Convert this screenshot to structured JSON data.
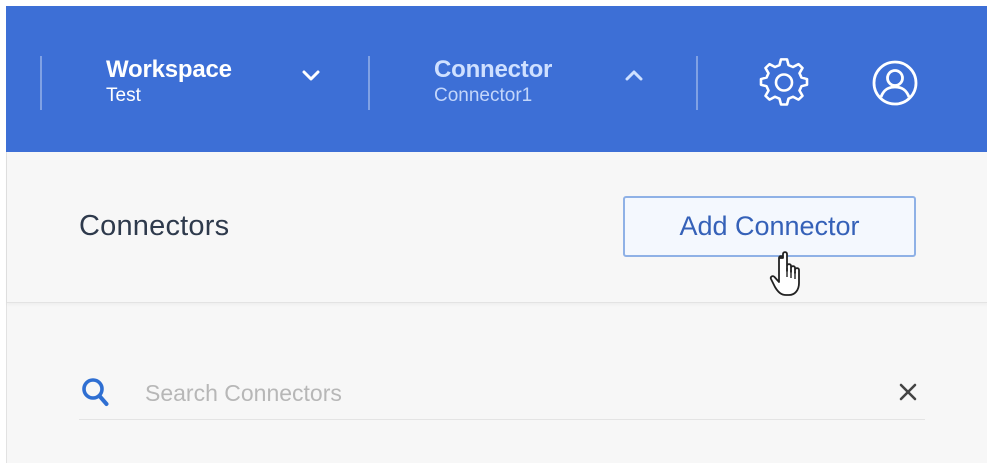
{
  "header": {
    "workspace": {
      "title": "Workspace",
      "value": "Test"
    },
    "connector": {
      "title": "Connector",
      "value": "Connector1"
    }
  },
  "panel": {
    "title": "Connectors",
    "add_button_label": "Add Connector",
    "search": {
      "placeholder": "Search Connectors",
      "value": ""
    }
  },
  "icons": {
    "workspace_toggle": "chevron-down-icon",
    "connector_toggle": "chevron-up-icon",
    "settings": "gear-icon",
    "account": "user-circle-icon",
    "search": "search-icon",
    "clear": "close-icon",
    "pointer": "hand-pointer-cursor"
  },
  "colors": {
    "header_bg": "#3d6fd6",
    "accent": "#2f6fd2",
    "button_border": "#8fb1e6",
    "button_text": "#3561b8",
    "panel_bg": "#f7f7f7"
  }
}
